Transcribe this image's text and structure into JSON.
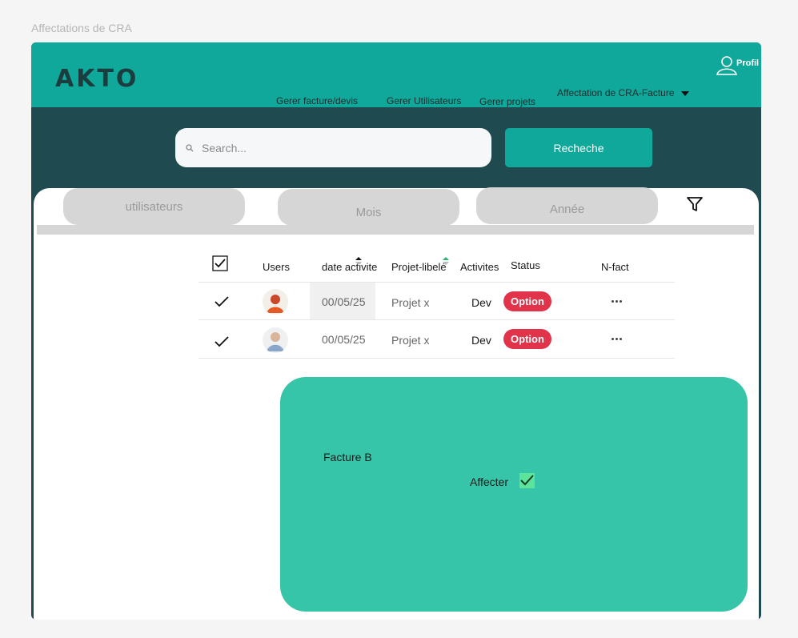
{
  "frame": {
    "title": "Affectations de CRA"
  },
  "header": {
    "logo": "AKTO",
    "nav": [
      "Gerer  facture/devis",
      "Gerer  Utilisateurs",
      "Gerer projets"
    ],
    "dropdown": "Affectation de CRA-Facture",
    "profile_label": "Profil",
    "icons": {
      "profile": "user-icon",
      "dropdown": "caret-down-icon"
    }
  },
  "search": {
    "placeholder": "Search...",
    "button_label": "Recheche",
    "icon": "search-icon"
  },
  "filters": {
    "items": [
      "utilisateurs",
      "Mois",
      "Année"
    ],
    "icon": "filter-icon"
  },
  "table": {
    "headers": [
      "Users",
      "date activite",
      "Projet-libelé",
      "Activites",
      "Status",
      "N-fact"
    ],
    "rows": [
      {
        "checked": true,
        "date": "00/05/25",
        "project": "Projet x",
        "activity": "Dev",
        "status": "Option",
        "menu": "more-icon"
      },
      {
        "checked": true,
        "date": "00/05/25",
        "project": "Projet x",
        "activity": "Dev",
        "status": "Option",
        "menu": "more-icon"
      }
    ]
  },
  "card": {
    "label": "Facture  B",
    "assign_label": "Affecter",
    "assign_checked": true
  },
  "colors": {
    "header": "#0fa89a",
    "background": "#1f4a50",
    "card": "#36c5a8",
    "badge": "#e1334a",
    "check": "#5ee39a"
  }
}
